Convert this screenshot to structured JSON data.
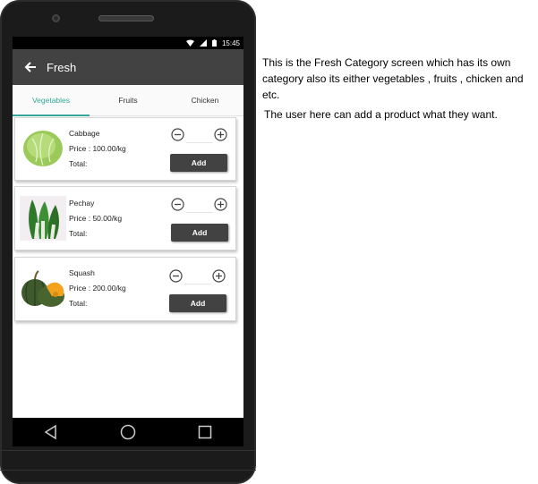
{
  "status_bar": {
    "time": "15:45"
  },
  "app_bar": {
    "title": "Fresh"
  },
  "tabs": [
    {
      "label": "Vegetables",
      "active": true
    },
    {
      "label": "Fruits",
      "active": false
    },
    {
      "label": "Chicken",
      "active": false
    }
  ],
  "products": [
    {
      "name": "Cabbage",
      "price": "Price : 100.00/kg",
      "total": "Total:",
      "add_label": "Add"
    },
    {
      "name": "Pechay",
      "price": "Price : 50.00/kg",
      "total": "Total:",
      "add_label": "Add"
    },
    {
      "name": "Squash",
      "price": "Price : 200.00/kg",
      "total": "Total:",
      "add_label": "Add"
    }
  ],
  "annotations": {
    "note_1": "This is the Fresh Category screen which has its own category also its either vegetables , fruits , chicken and etc.",
    "note_2": "The user here can add a product what they want."
  },
  "colors": {
    "accent": "#34a79a",
    "app_bar": "#424242",
    "button": "#424242"
  },
  "icons": [
    "back-arrow-icon",
    "wifi-icon",
    "signal-icon",
    "battery-icon",
    "minus-circle-icon",
    "plus-circle-icon",
    "nav-back-icon",
    "nav-home-icon",
    "nav-recents-icon"
  ]
}
